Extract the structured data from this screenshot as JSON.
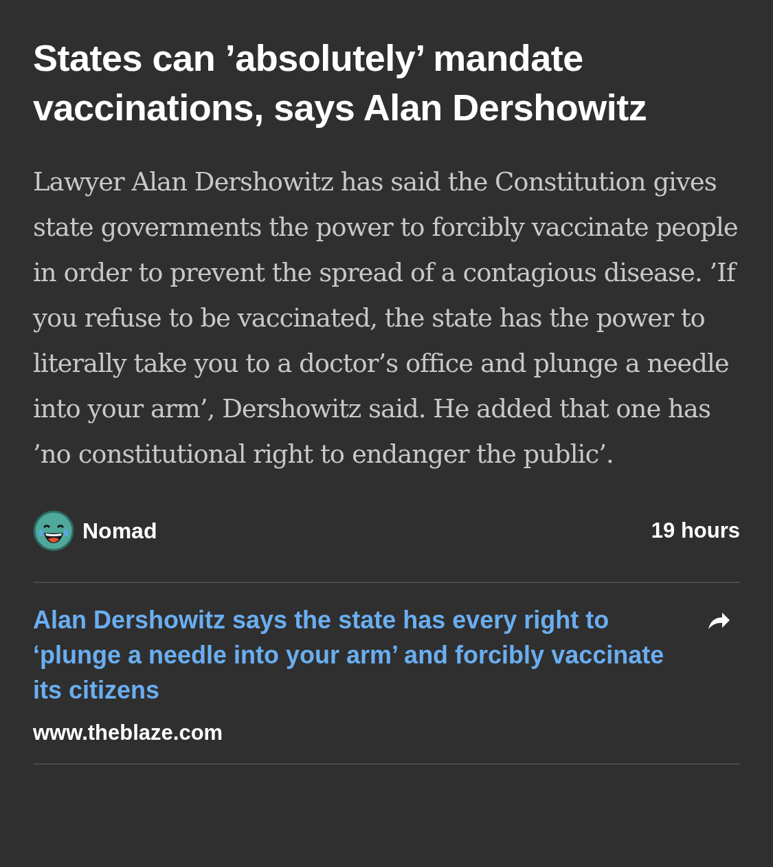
{
  "headline": "States can ’absolutely’ mandate vaccinations, says Alan Dershowitz",
  "summary": "Lawyer Alan Dershowitz has said the Constitution gives state governments the power to forcibly vaccinate people in order to prevent the spread of a contagious disease. ’If you refuse to be vaccinated, the state has the power to literally take you to a doctor’s office and plunge a needle into your arm’, Dershowitz said. He added that one has ’no constitutional right to endanger the public’.",
  "author": {
    "name": "Nomad",
    "time": "19 hours"
  },
  "link": {
    "title": "Alan Dershowitz says the state has every right to ‘plunge a needle into your arm’ and forcibly vaccinate its citizens",
    "domain": "www.theblaze.com"
  }
}
